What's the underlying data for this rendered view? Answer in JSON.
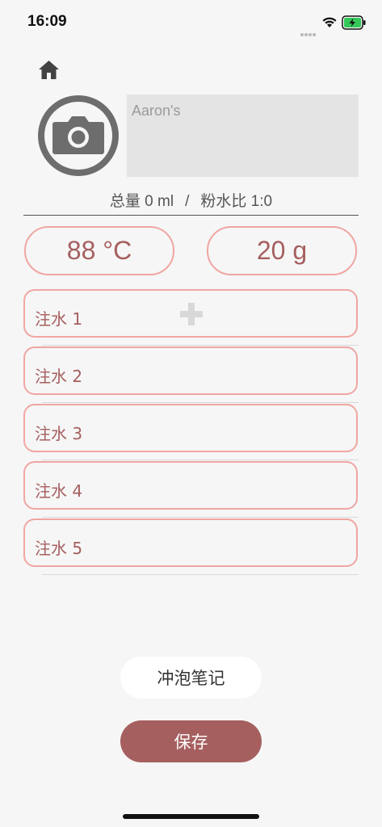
{
  "status_bar": {
    "time": "16:09",
    "icons": [
      "signal-icon",
      "wifi-icon",
      "battery-charging-icon"
    ],
    "battery_color": "#34c759"
  },
  "header": {
    "home_icon": "home-icon"
  },
  "profile": {
    "camera_icon": "camera-icon",
    "name_placeholder": "Aaron's"
  },
  "summary": {
    "total": "总量 0 ml",
    "separator": "/",
    "ratio": "粉水比 1:0"
  },
  "params": {
    "temperature": "88 °C",
    "weight": "20 g"
  },
  "pours": [
    {
      "label": "注水 1"
    },
    {
      "label": "注水 2"
    },
    {
      "label": "注水 3"
    },
    {
      "label": "注水 4"
    },
    {
      "label": "注水 5"
    }
  ],
  "actions": {
    "notes_label": "冲泡笔记",
    "save_label": "保存"
  },
  "colors": {
    "accent": "#a65f5f",
    "border": "#f0a6a2",
    "background": "#f6f6f6"
  }
}
